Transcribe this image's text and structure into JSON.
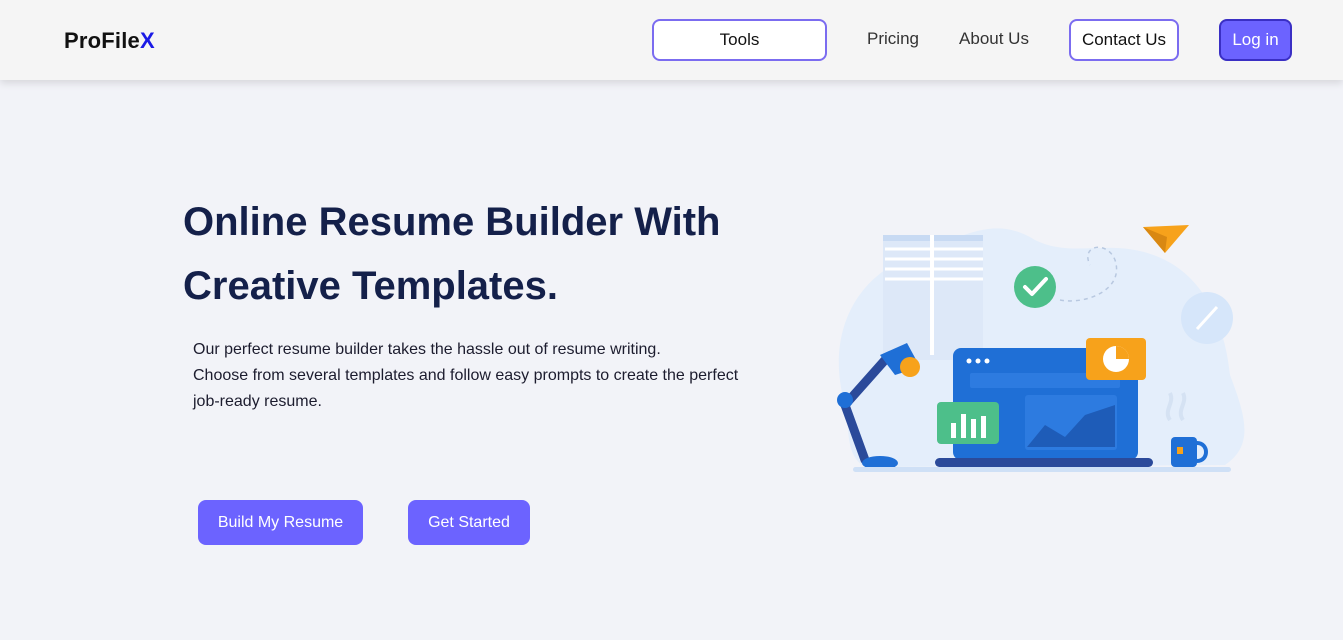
{
  "navbar": {
    "brand_main": "ProFile",
    "brand_accent": "X",
    "tools_label": "Tools",
    "pricing_label": "Pricing",
    "about_label": "About Us",
    "contact_label": "Contact Us",
    "login_label": "Log in"
  },
  "hero": {
    "title_line1": "Online Resume Builder With",
    "title_line2": "Creative Templates.",
    "desc_line1": "Our perfect resume builder takes the hassle out of resume writing.",
    "desc_line2": "Choose from several templates and follow easy prompts to create the perfect",
    "desc_line3": "job-ready resume.",
    "build_button": "Build My Resume",
    "start_button": "Get Started"
  },
  "illustration": {
    "icon": "workspace-illustration"
  },
  "colors": {
    "accent": "#6c63ff",
    "brand_accent": "#1a1ae6",
    "heading": "#14204a",
    "background": "#f2f3f8"
  }
}
